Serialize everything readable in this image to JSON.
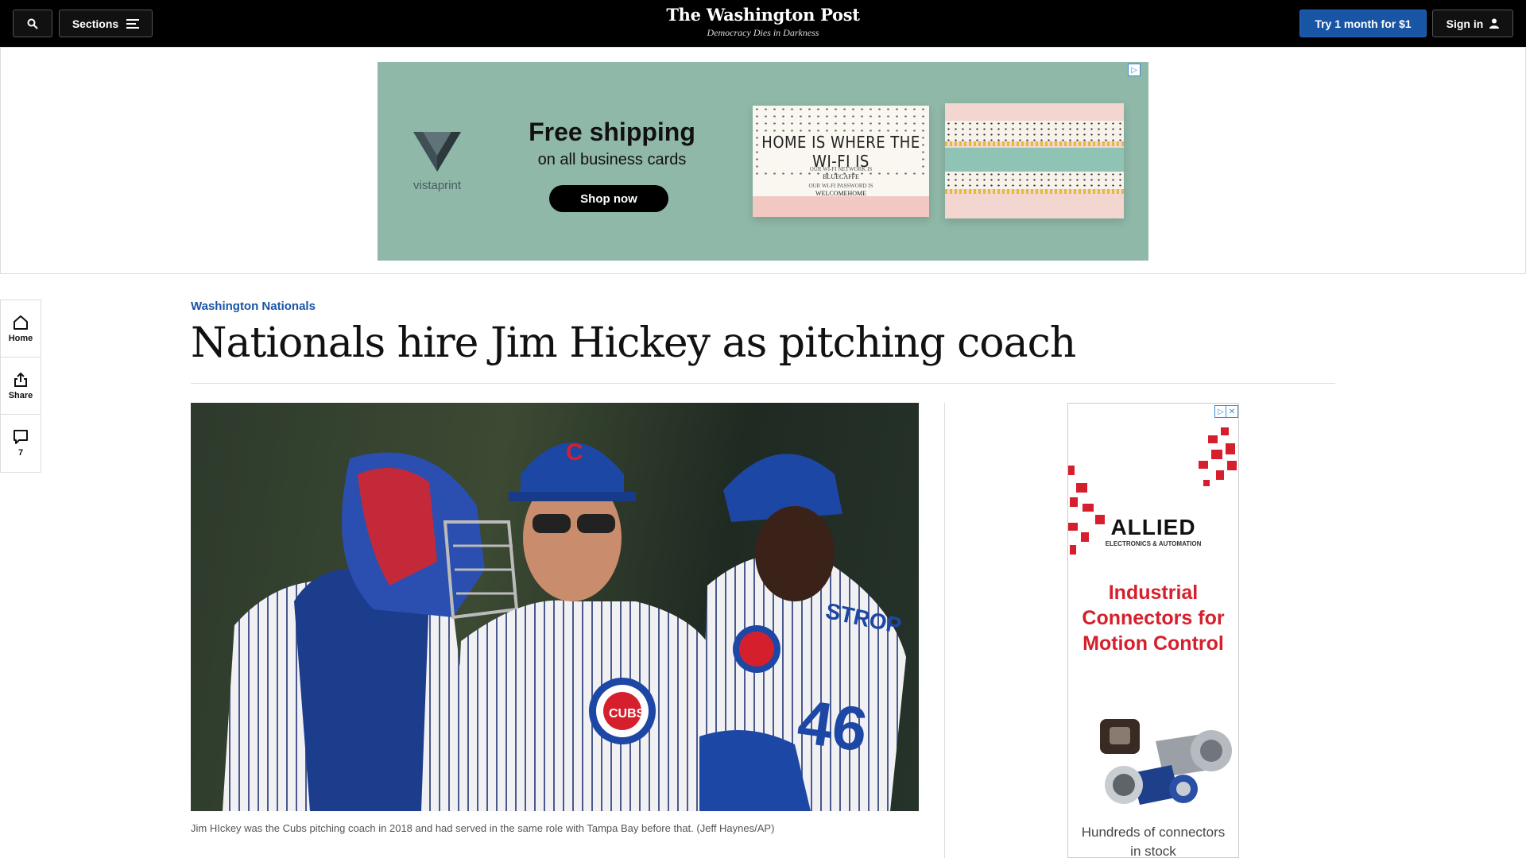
{
  "header": {
    "search_label": "",
    "sections_label": "Sections",
    "logo": "The Washington Post",
    "tagline": "Democracy Dies in Darkness",
    "subscribe_label": "Try 1 month for $1",
    "signin_label": "Sign in"
  },
  "top_ad": {
    "brand": "vistaprint",
    "headline": "Free shipping",
    "subheadline": "on all business cards",
    "cta": "Shop now",
    "card_text": "HOME IS WHERE THE WI-FI IS",
    "card_network_label": "OUR WI-FI NETWORK IS",
    "card_network": "BLUECAFFE",
    "card_password_label": "OUR WI-FI PASSWORD IS",
    "card_password": "WELCOMEHOME",
    "colors": {
      "background": "#8fb8a8",
      "cta": "#000000"
    }
  },
  "rail": {
    "home_label": "Home",
    "share_label": "Share",
    "comments_count": "7"
  },
  "article": {
    "kicker": "Washington Nationals",
    "headline": "Nationals hire Jim Hickey as pitching coach",
    "caption": "Jim HIckey was the Cubs pitching coach in 2018 and had served in the same role with Tampa Bay before that. (Jeff Haynes/AP)",
    "photo_jersey_number": "46",
    "photo_jersey_name": "STROP",
    "photo_logo": "CUBS"
  },
  "side_ad": {
    "brand": "ALLIED",
    "brand_sub": "ELECTRONICS & AUTOMATION",
    "headline": "Industrial Connectors for Motion Control",
    "footer": "Hundreds of connectors in stock",
    "colors": {
      "accent": "#d61f2c"
    }
  },
  "colors": {
    "accent_blue": "#1955a5",
    "topbar": "#000000"
  }
}
